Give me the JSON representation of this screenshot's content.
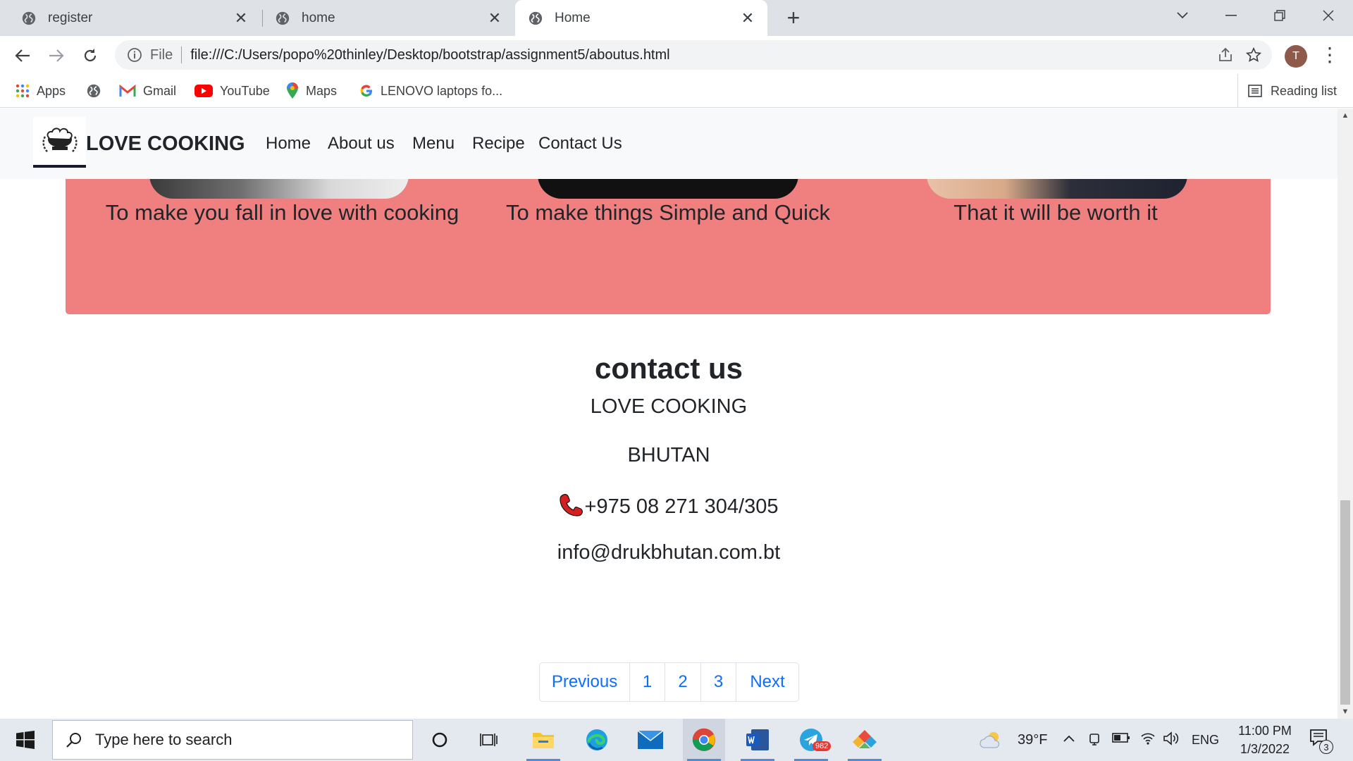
{
  "browser": {
    "tabs": [
      {
        "label": "register",
        "active": false
      },
      {
        "label": "home",
        "active": false
      },
      {
        "label": "Home",
        "active": true
      }
    ],
    "address": {
      "scheme_label": "File",
      "url": "file:///C:/Users/popo%20thinley/Desktop/bootstrap/assignment5/aboutus.html"
    },
    "profile_initial": "T",
    "bookmarks": [
      {
        "label": "Apps",
        "icon": "apps-grid-icon"
      },
      {
        "label": "",
        "icon": "globe-icon"
      },
      {
        "label": "Gmail",
        "icon": "gmail-icon"
      },
      {
        "label": "YouTube",
        "icon": "youtube-icon"
      },
      {
        "label": "Maps",
        "icon": "maps-pin-icon"
      },
      {
        "label": "LENOVO laptops fo...",
        "icon": "google-g-icon"
      }
    ],
    "reading_list": "Reading list"
  },
  "page": {
    "brand": "LOVE COOKING",
    "nav": [
      "Home",
      "About us",
      "Menu",
      "Recipe",
      "Contact Us"
    ],
    "features": [
      "To make you fall in love with cooking",
      "To make things Simple and Quick",
      "That it will be worth it"
    ],
    "contact": {
      "title": "contact us",
      "name": "LOVE COOKING",
      "country": "BHUTAN",
      "phone": "+975 08 271 304/305",
      "email": "info@drukbhutan.com.bt"
    },
    "pagination": [
      "Previous",
      "1",
      "2",
      "3",
      "Next"
    ]
  },
  "taskbar": {
    "search_placeholder": "Type here to search",
    "telegram_badge": "982",
    "weather": "39°F",
    "language": "ENG",
    "time": "11:00 PM",
    "date": "1/3/2022",
    "notifications": "3"
  },
  "colors": {
    "pink_section": "#f08080",
    "link_blue": "#0d6efd",
    "navbar_bg": "#f8f9fa",
    "tab_strip": "#dee1e6"
  }
}
